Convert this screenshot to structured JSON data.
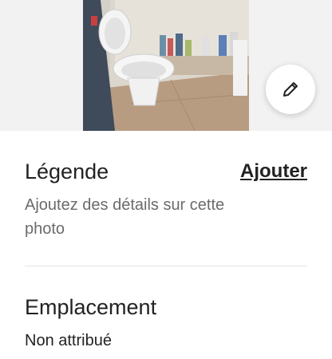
{
  "photo": {
    "icon": "photo-thumbnail"
  },
  "edit_button": {
    "icon": "pencil-icon"
  },
  "caption": {
    "title": "Légende",
    "action": "Ajouter",
    "hint": "Ajoutez des détails sur cette photo"
  },
  "location": {
    "title": "Emplacement",
    "value": "Non attribué"
  }
}
